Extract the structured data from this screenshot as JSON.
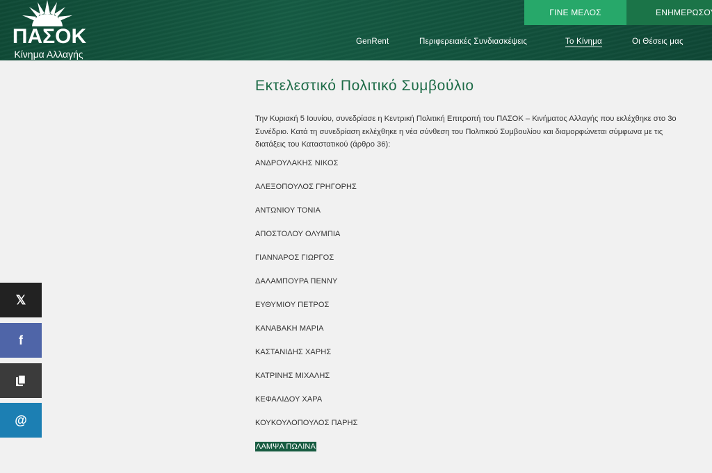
{
  "brand": {
    "name": "ΠΑΣΟΚ",
    "tagline": "Κίνημα Αλλαγής"
  },
  "top_buttons": {
    "member": "ΓΙΝΕ ΜΕΛΟΣ",
    "news": "ΕΝΗΜΕΡΩΣΟΥ"
  },
  "nav": {
    "items": [
      "GenRent",
      "Περιφερειακές Συνδιασκέψεις",
      "Το Κίνημα",
      "Οι Θέσεις μας"
    ],
    "active": "Το Κίνημα"
  },
  "page": {
    "title": "Εκτελεστικό Πολιτικό Συμβούλιο",
    "intro": "Την Κυριακή 5 Ιουνίου, συνεδρίασε η Κεντρική Πολιτική Επιτροπή του ΠΑΣΟΚ – Κινήματος Αλλαγής που εκλέχθηκε στο 3ο Συνέδριο. Κατά τη συνεδρίαση εκλέχθηκε η νέα σύνθεση του Πολιτικού Συμβουλίου και διαμορφώνεται σύμφωνα με τις διατάξεις του Καταστατικού (άρθρο 36):",
    "members": [
      "ΑΝΔΡΟΥΛΑΚΗΣ ΝΙΚΟΣ",
      "ΑΛΕΞΟΠΟΥΛΟΣ ΓΡΗΓΟΡΗΣ",
      "ΑΝΤΩΝΙΟΥ ΤΟΝΙΑ",
      "ΑΠΟΣΤΟΛΟΥ ΟΛΥΜΠΙΑ",
      "ΓΙΑΝΝΑΡΟΣ ΓΙΩΡΓΟΣ",
      "ΔΑΛΑΜΠΟΥΡΑ ΠΕΝΝΥ",
      "ΕΥΘΥΜΙΟΥ ΠΕΤΡΟΣ",
      "ΚΑΝΑΒΑΚΗ ΜΑΡΙΑ",
      "ΚΑΣΤΑΝΙΔΗΣ ΧΑΡΗΣ",
      "ΚΑΤΡΙΝΗΣ ΜΙΧΑΛΗΣ",
      "ΚΕΦΑΛΙΔΟΥ ΧΑΡΑ",
      "ΚΟΥΚΟΥΛΟΠΟΥΛΟΣ ΠΑΡΗΣ",
      "ΛΑΜΨΑ ΠΩΛΙΝΑ"
    ],
    "highlighted_member": "ΛΑΜΨΑ ΠΩΛΙΝΑ"
  },
  "share": {
    "x_icon": "x-icon",
    "facebook_icon": "facebook-icon",
    "copy_icon": "copy-icon",
    "email_icon": "at-sign-icon",
    "x_glyph": "𝕏",
    "facebook_glyph": "f",
    "email_glyph": "@"
  },
  "colors": {
    "brand_green": "#1d6b47",
    "member_button": "#27a86a",
    "news_button": "#1b7448",
    "facebook": "#4f65a8",
    "email": "#1c7fb3"
  }
}
